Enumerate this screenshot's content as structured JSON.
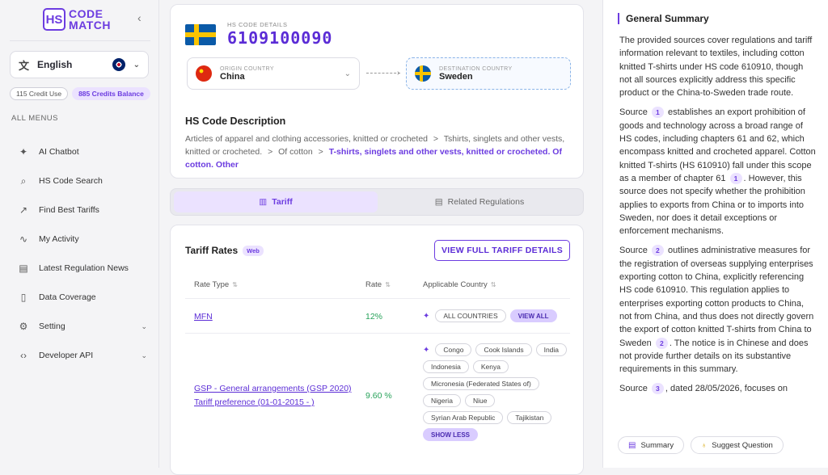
{
  "brand": {
    "mark": "HS",
    "line1": "CODE",
    "line2": "MATCH"
  },
  "language": {
    "label": "English"
  },
  "credits": {
    "used": "115 Credit Use",
    "balance": "885 Credits Balance"
  },
  "menu_heading": "ALL MENUS",
  "menu": [
    {
      "label": "AI Chatbot",
      "icon": "sparkle-icon"
    },
    {
      "label": "HS Code Search",
      "icon": "search-icon"
    },
    {
      "label": "Find Best Tariffs",
      "icon": "trend-icon"
    },
    {
      "label": "My Activity",
      "icon": "pulse-icon"
    },
    {
      "label": "Latest Regulation News",
      "icon": "news-icon"
    },
    {
      "label": "Data Coverage",
      "icon": "document-icon"
    },
    {
      "label": "Setting",
      "icon": "gear-icon"
    },
    {
      "label": "Developer API",
      "icon": "code-icon"
    }
  ],
  "hs": {
    "label": "HS CODE DETAILS",
    "code": "6109100090",
    "origin_label": "ORIGIN COUNTRY",
    "origin": "China",
    "dest_label": "DESTINATION COUNTRY",
    "dest": "Sweden",
    "desc_title": "HS Code Description",
    "desc_part1": "Articles of apparel and clothing accessories, knitted or crocheted",
    "desc_part2": "Tshirts, singlets and other vests, knitted or crocheted.",
    "desc_part3": "Of cotton",
    "desc_highlight": "T-shirts, singlets and other vests, knitted or crocheted. Of cotton. Other",
    "sep": ">"
  },
  "tabs": {
    "tariff": "Tariff",
    "regulations": "Related Regulations"
  },
  "tariff": {
    "title": "Tariff Rates",
    "badge": "Web",
    "view_full": "VIEW FULL TARIFF DETAILS",
    "col_type": "Rate Type",
    "col_rate": "Rate",
    "col_country": "Applicable Country",
    "sort_glyph": "⇅",
    "rows": [
      {
        "type": "MFN",
        "rate": "12%",
        "countries": [
          "ALL COUNTRIES"
        ],
        "action": "VIEW ALL"
      },
      {
        "type": "GSP - General arrangements (GSP 2020) Tariff preference (01-01-2015 - )",
        "rate": "9.60 %",
        "countries": [
          "Congo",
          "Cook Islands",
          "India",
          "Indonesia",
          "Kenya",
          "Micronesia (Federated States of)",
          "Nigeria",
          "Niue",
          "Syrian Arab Republic",
          "Tajikistan"
        ],
        "action": "SHOW LESS"
      }
    ]
  },
  "summary": {
    "title": "General Summary",
    "p1": "The provided sources cover regulations and tariff information relevant to textiles, including cotton knitted T-shirts under HS code 610910, though not all sources explicitly address this specific product or the China-to-Sweden trade route.",
    "source_word": "Source",
    "s1": "1",
    "p2a": "establishes an export prohibition of goods and technology across a broad range of HS codes, including chapters 61 and 62, which encompass knitted and crocheted apparel. Cotton knitted T-shirts (HS 610910) fall under this scope as a member of chapter 61",
    "p2b": ". However, this source does not specify whether the prohibition applies to exports from China or to imports into Sweden, nor does it detail exceptions or enforcement mechanisms.",
    "s2": "2",
    "p3a": "outlines administrative measures for the registration of overseas supplying enterprises exporting cotton to China, explicitly referencing HS code 610910. This regulation applies to enterprises exporting cotton products to China, not from China, and thus does not directly govern the export of cotton knitted T-shirts from China to Sweden",
    "p3b": ". The notice is in Chinese and does not provide further details on its substantive requirements in this summary.",
    "s3": "3",
    "p4": ", dated 28/05/2026, focuses on",
    "btn_summary": "Summary",
    "btn_suggest": "Suggest Question"
  }
}
